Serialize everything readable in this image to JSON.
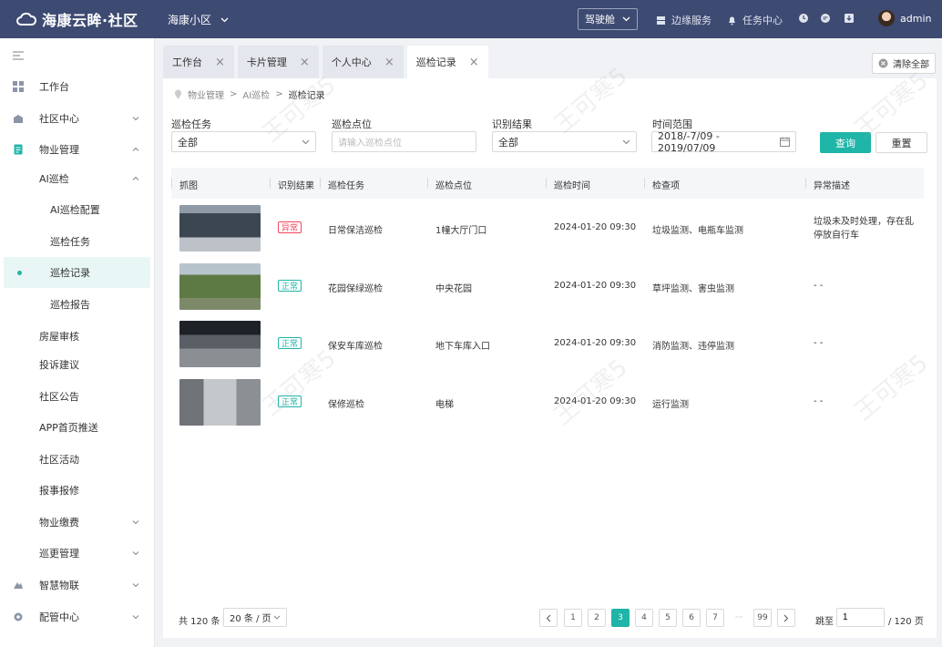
{
  "app": {
    "brand": "海康云眸·社区",
    "community": "海康小区"
  },
  "topbar": {
    "cockpit": "驾驶舱",
    "edge_service": "边缘服务",
    "task_center": "任务中心",
    "user_name": "admin"
  },
  "sidebar": {
    "items": [
      {
        "label": "工作台"
      },
      {
        "label": "社区中心"
      },
      {
        "label": "物业管理"
      },
      {
        "label": "AI巡检"
      },
      {
        "label": "AI巡检配置"
      },
      {
        "label": "巡检任务"
      },
      {
        "label": "巡检记录"
      },
      {
        "label": "巡检报告"
      },
      {
        "label": "房屋审核"
      },
      {
        "label": "投诉建议"
      },
      {
        "label": "社区公告"
      },
      {
        "label": "APP首页推送"
      },
      {
        "label": "社区活动"
      },
      {
        "label": "报事报修"
      },
      {
        "label": "物业缴费"
      },
      {
        "label": "巡更管理"
      },
      {
        "label": "智慧物联"
      },
      {
        "label": "配管中心"
      }
    ]
  },
  "tabs": [
    {
      "label": "工作台"
    },
    {
      "label": "卡片管理"
    },
    {
      "label": "个人中心"
    },
    {
      "label": "巡检记录"
    }
  ],
  "clear_all": "清除全部",
  "breadcrumb": {
    "items": [
      "物业管理",
      "AI巡检",
      "巡检记录"
    ]
  },
  "filters": {
    "task": {
      "label": "巡检任务",
      "value": "全部"
    },
    "point": {
      "label": "巡检点位",
      "placeholder": "请输入巡检点位"
    },
    "result": {
      "label": "识别结果",
      "value": "全部"
    },
    "range": {
      "label": "时间范围",
      "value": "2018/-7/09 - 2019/07/09"
    },
    "query": "查询",
    "reset": "重置"
  },
  "table": {
    "headers": [
      "抓图",
      "识别结果",
      "巡检任务",
      "巡检点位",
      "巡检时间",
      "检查项",
      "异常描述"
    ],
    "rows": [
      {
        "result": "异常",
        "task": "日常保洁巡检",
        "point": "1幢大厅门口",
        "time": "2024-01-20 09:30",
        "items": "垃圾监测、电瓶车监测",
        "desc": "垃圾未及时处理，存在乱停放自行车"
      },
      {
        "result": "正常",
        "task": "花园保绿巡检",
        "point": "中央花园",
        "time": "2024-01-20 09:30",
        "items": "草坪监测、害虫监测",
        "desc": "- -"
      },
      {
        "result": "正常",
        "task": "保安车库巡检",
        "point": "地下车库入口",
        "time": "2024-01-20 09:30",
        "items": "消防监测、违停监测",
        "desc": "- -"
      },
      {
        "result": "正常",
        "task": "保修巡检",
        "point": "电梯",
        "time": "2024-01-20 09:30",
        "items": "运行监测",
        "desc": "- -"
      }
    ]
  },
  "pagination": {
    "total": "共 120 条",
    "page_size": "20 条 / 页",
    "pages": [
      "1",
      "2",
      "3",
      "4",
      "5",
      "6",
      "7",
      "···",
      "99"
    ],
    "current": "3",
    "jump_label": "跳至",
    "jump_value": "1",
    "total_pages": "/ 120 页"
  },
  "watermark": "王可寒5",
  "colors": {
    "topbar": "#3d4a72",
    "accent": "#1fb5a8",
    "abnormal": "#f5465d"
  }
}
